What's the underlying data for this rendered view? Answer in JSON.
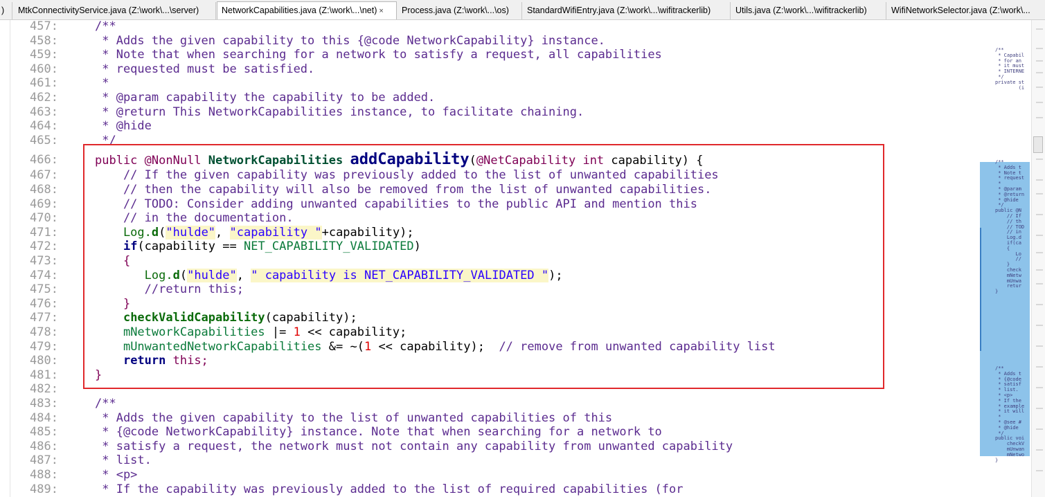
{
  "tabs": [
    {
      "label": ")"
    },
    {
      "label": "MtkConnectivityService.java (Z:\\work\\...\\server)"
    },
    {
      "label": "NetworkCapabilities.java (Z:\\work\\...\\net)",
      "close": "×"
    },
    {
      "label": "Process.java (Z:\\work\\...\\os)"
    },
    {
      "label": "StandardWifiEntry.java (Z:\\work\\...\\wifitrackerlib)"
    },
    {
      "label": "Utils.java (Z:\\work\\...\\wifitrackerlib)"
    },
    {
      "label": "WifiNetworkSelector.java (Z:\\work\\..."
    }
  ],
  "line_numbers": [
    "457:",
    "458:",
    "459:",
    "460:",
    "461:",
    "462:",
    "463:",
    "464:",
    "465:",
    "466:",
    "467:",
    "468:",
    "469:",
    "470:",
    "471:",
    "472:",
    "473:",
    "474:",
    "475:",
    "476:",
    "477:",
    "478:",
    "479:",
    "480:",
    "481:",
    "482:",
    "483:",
    "484:",
    "485:",
    "486:",
    "487:",
    "488:",
    "489:"
  ],
  "code": {
    "l457": "/**",
    "l458": " * Adds the given capability to this {@code NetworkCapability} instance.",
    "l459": " * Note that when searching for a network to satisfy a request, all capabilities",
    "l460": " * requested must be satisfied.",
    "l461": " *",
    "l462": " * @param capability the capability to be added.",
    "l463": " * @return This NetworkCapabilities instance, to facilitate chaining.",
    "l464": " * @hide",
    "l465": " */",
    "l466_public": "public ",
    "l466_ann": "@NonNull ",
    "l466_type": "NetworkCapabilities ",
    "l466_fn": "addCapability",
    "l466_open": "(",
    "l466_ann2": "@NetCapability ",
    "l466_int": "int ",
    "l466_rest": "capability) {",
    "l467": "    // If the given capability was previously added to the list of unwanted capabilities",
    "l468": "    // then the capability will also be removed from the list of unwanted capabilities.",
    "l469": "    // TODO: Consider adding unwanted capabilities to the public API and mention this",
    "l470": "    // in the documentation.",
    "l471_pre": "    Log.",
    "l471_d": "d",
    "l471_p": "(",
    "l471_s1": "\"hulde\"",
    "l471_c": ", ",
    "l471_s2": "\"capability \"",
    "l471_end": "+capability);",
    "l472_pre": "    ",
    "l472_if": "if",
    "l472_a": "(capability == ",
    "l472_cn": "NET_CAPABILITY_VALIDATED",
    "l472_b": ")",
    "l473": "    {",
    "l474_pre": "       Log.",
    "l474_d": "d",
    "l474_p": "(",
    "l474_s1": "\"hulde\"",
    "l474_c": ", ",
    "l474_s2": "\" capability is NET_CAPABILITY_VALIDATED \"",
    "l474_end": ");",
    "l475": "       //return this;",
    "l476": "    }",
    "l477_pre": "    ",
    "l477_m": "checkValidCapability",
    "l477_end": "(capability);",
    "l478_pre": "    ",
    "l478_f": "mNetworkCapabilities",
    "l478_op": " |= ",
    "l478_n": "1",
    "l478_end": " << capability;",
    "l479_pre": "    ",
    "l479_f": "mUnwantedNetworkCapabilities",
    "l479_op": " &= ~(",
    "l479_n": "1",
    "l479_mid": " << capability);  ",
    "l479_cm": "// remove from unwanted capability list",
    "l480_pre": "    ",
    "l480_kw": "return",
    "l480_end": " this;",
    "l481": "}",
    "l483": "/**",
    "l484": " * Adds the given capability to the list of unwanted capabilities of this",
    "l485": " * {@code NetworkCapability} instance. Note that when searching for a network to",
    "l486": " * satisfy a request, the network must not contain any capability from unwanted capability",
    "l487": " * list.",
    "l488": " * <p>",
    "l489": " * If the capability was previously added to the list of required capabilities (for"
  },
  "minimap": {
    "block1": "/**\n * Capabil\n * for an\n * it must\n * INTERNE\n */\nprivate st\n        (i",
    "block2": "/**\n * Adds t\n * Note t\n * request\n *\n * @param\n * @return\n * @hide\n */\npublic @N\n    // If\n    // th\n    // TOD\n    // in\n    Log.d\n    if(ca\n    {\n       Lo\n       //\n    }\n    check\n    mNetw\n    mUnwa\n    retur\n}",
    "block3": "/**\n * Adds t\n * {@code\n * satisf\n * list.\n * <p>\n * If the\n * example\n * it will\n *\n * @see #\n * @hide\n */\npublic voi\n    checkV\n    mUnwan\n    mNetwo\n}"
  },
  "colors": {
    "highlight_border": "#e0282b",
    "minimap_highlight": "#8dc3ea",
    "string_bg": "#fbf6c8"
  }
}
